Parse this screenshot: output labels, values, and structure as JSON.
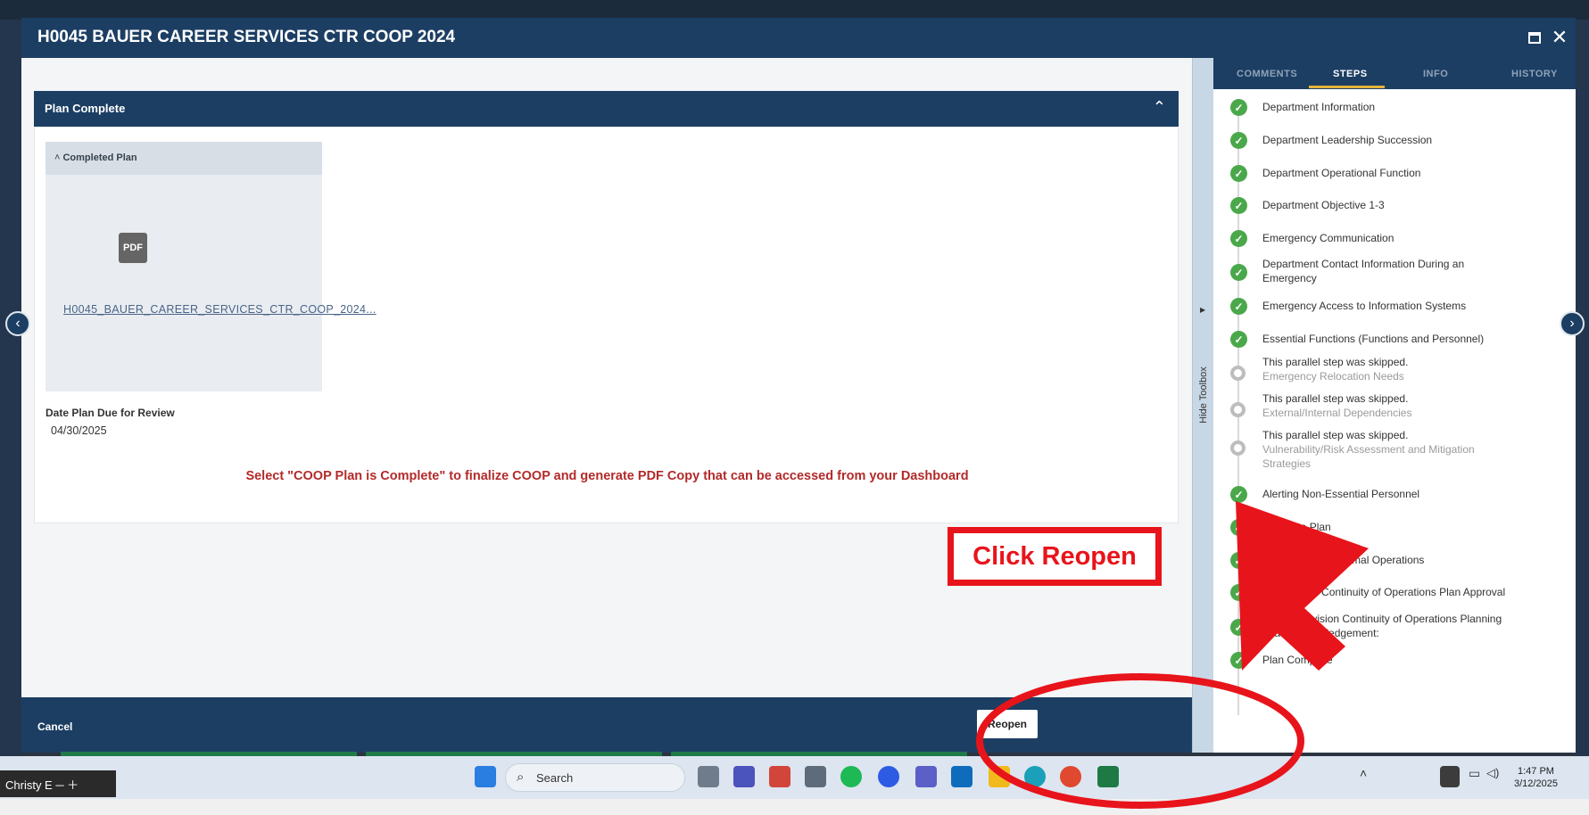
{
  "modal": {
    "title": "H0045 BAUER CAREER SERVICES CTR COOP 2024",
    "section_title": "Plan Complete",
    "card_title": "Completed Plan",
    "pdf_badge": "PDF",
    "pdf_link": "H0045_BAUER_CAREER_SERVICES_CTR_COOP_2024...",
    "due_label": "Date Plan Due for Review",
    "due_value": "04/30/2025",
    "instruction": "Select \"COOP Plan is Complete\" to finalize COOP and generate PDF Copy that can be accessed from your Dashboard",
    "cancel_label": "Cancel",
    "reopen_label": "Reopen",
    "hide_toolbox": "Hide Toolbox"
  },
  "tabs": [
    {
      "label": "COMMENTS"
    },
    {
      "label": "STEPS"
    },
    {
      "label": "INFO"
    },
    {
      "label": "HISTORY"
    }
  ],
  "steps": [
    {
      "label": "Department Information",
      "status": "done"
    },
    {
      "label": "Department Leadership Succession",
      "status": "done"
    },
    {
      "label": "Department Operational Function",
      "status": "done"
    },
    {
      "label": "Department Objective 1-3",
      "status": "done"
    },
    {
      "label": "Emergency Communication",
      "status": "done"
    },
    {
      "label": "Department Contact Information During an Emergency",
      "status": "done"
    },
    {
      "label": "Emergency Access to Information Systems",
      "status": "done"
    },
    {
      "label": "Essential Functions (Functions and Personnel)",
      "status": "done"
    },
    {
      "label": "This parallel step was skipped.",
      "sub": "Emergency Relocation Needs",
      "status": "skipped"
    },
    {
      "label": "This parallel step was skipped.",
      "sub": "External/Internal Dependencies",
      "status": "skipped"
    },
    {
      "label": "This parallel step was skipped.",
      "sub": "Vulnerability/Risk Assessment and Mitigation Strategies",
      "status": "skipped"
    },
    {
      "label": "Alerting Non-Essential Personnel",
      "status": "done"
    },
    {
      "label": "Return to Plan",
      "status": "done"
    },
    {
      "label": "Resumption of Normal Operations",
      "status": "done"
    },
    {
      "label": "Department Continuity of Operations Plan Approval",
      "status": "done"
    },
    {
      "label": "College/Division Continuity of Operations Planning Lead Acknowledgement:",
      "status": "done"
    },
    {
      "label": "Plan Complete",
      "status": "done"
    }
  ],
  "annotation": {
    "callout": "Click Reopen",
    "color": "#e8141b"
  },
  "taskbar": {
    "search_label": "Search",
    "time": "1:47 PM",
    "date": "3/12/2025",
    "user_chip": "Christy E"
  },
  "colors": {
    "header": "#1c3e63",
    "step_done": "#4aa84a",
    "instruction": "#b32a2a",
    "tab_accent": "#e5b43a"
  }
}
